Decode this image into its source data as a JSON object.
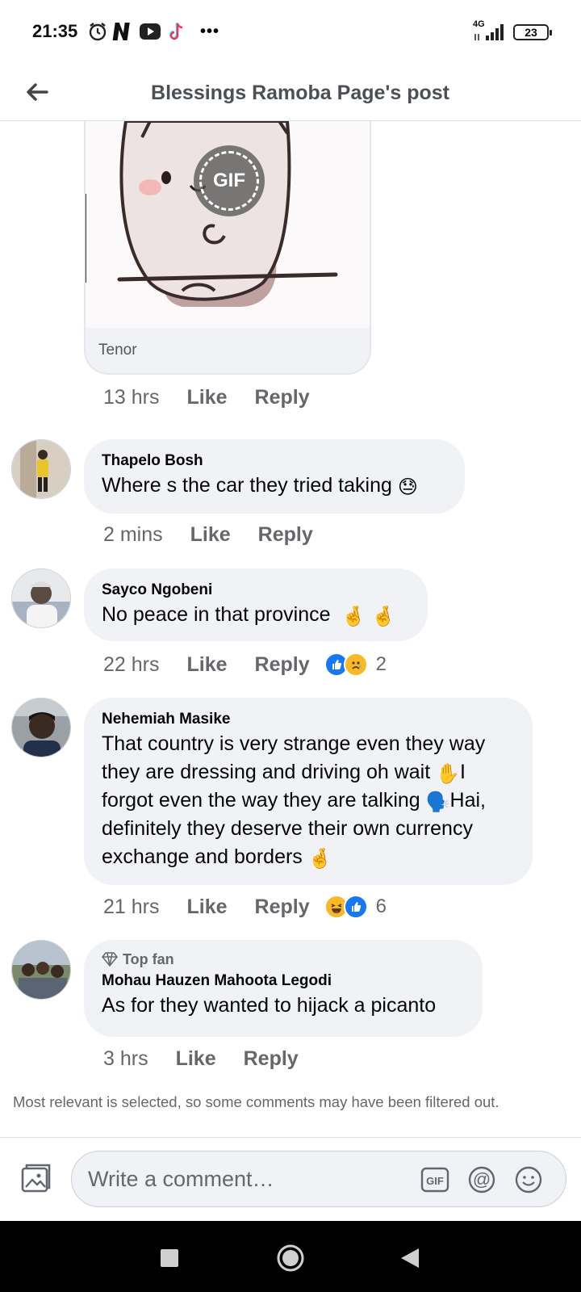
{
  "status_bar": {
    "time": "21:35",
    "network": "4G",
    "battery": "23",
    "more_indicator": "•••",
    "icons": [
      "alarm-icon",
      "netflix-icon",
      "youtube-icon",
      "tiktok-icon"
    ]
  },
  "header": {
    "title": "Blessings Ramoba Page's post",
    "back_icon": "arrow-left-icon"
  },
  "gif_card": {
    "badge": "GIF",
    "source": "Tenor",
    "time": "13 hrs",
    "like": "Like",
    "reply": "Reply"
  },
  "comments": [
    {
      "name": "Thapelo Bosh",
      "text": "Where s the car they tried taking",
      "emoji": "😓",
      "time": "2 mins",
      "like": "Like",
      "reply": "Reply"
    },
    {
      "name": "Sayco Ngobeni",
      "text": "No peace in that province",
      "emoji": "🤞 🤞",
      "time": "22 hrs",
      "like": "Like",
      "reply": "Reply",
      "reactions": [
        "like",
        "sad"
      ],
      "reaction_count": "2"
    },
    {
      "name": "Nehemiah Masike",
      "lines": [
        "That country is very strange even they way",
        "they are dressing and driving oh wait",
        "I",
        "forgot even the way they are talking",
        "Hai,",
        "definitely they deserve their own currency",
        "exchange and borders"
      ],
      "emojis": [
        "✋",
        "🗣️",
        "🤞"
      ],
      "time": "21 hrs",
      "like": "Like",
      "reply": "Reply",
      "reactions": [
        "haha",
        "like"
      ],
      "reaction_count": "6"
    },
    {
      "badge": "Top fan",
      "name": "Mohau Hauzen Mahoota Legodi",
      "text": "As for they wanted to hijack a picanto",
      "time": "3 hrs",
      "like": "Like",
      "reply": "Reply"
    }
  ],
  "filter_note": "Most relevant is selected, so some comments may have been filtered out.",
  "composer": {
    "placeholder": "Write a comment…",
    "icons": [
      "photo-icon",
      "gif-icon",
      "mention-icon",
      "emoji-icon"
    ]
  },
  "nav": {
    "icons": [
      "recents-square-icon",
      "home-circle-icon",
      "back-triangle-icon"
    ]
  },
  "colors": {
    "bubble": "#f0f2f5",
    "meta_text": "#65676b",
    "like_blue": "#1877f2",
    "emoji_yellow": "#f7b928"
  }
}
